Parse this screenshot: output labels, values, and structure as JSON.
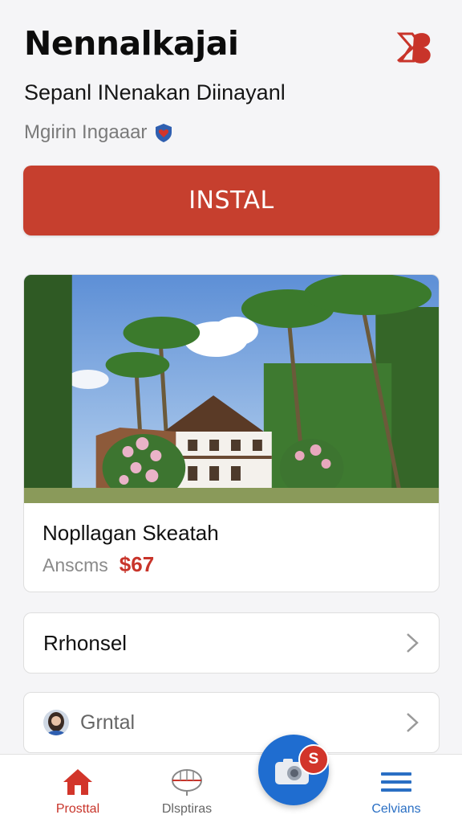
{
  "header": {
    "title": "Nennalkajai",
    "subtitle": "Sepanl INenakan Diinayanl",
    "tagline": "Mgirin Ingaaar",
    "tagline_icon": "heart-shield-icon",
    "logo_icon": "brand-logo-icon"
  },
  "install_button": {
    "label": "INSTAL"
  },
  "card": {
    "image": "tropical-palm-house-photo",
    "title": "Nopllagan Skeatah",
    "meta_label": "Anscms",
    "price": "$67"
  },
  "rows": [
    {
      "label": "Rrhonsel",
      "icon": "chevron-right-icon"
    },
    {
      "label": "Grntal",
      "icon": "chevron-right-icon",
      "avatar": "avatar"
    }
  ],
  "tabbar": {
    "tabs": [
      {
        "label": "Prosttal",
        "icon": "home-icon",
        "active": true
      },
      {
        "label": "Dlsptiras",
        "icon": "globe-icon",
        "active": false
      },
      {
        "label": "Celvians",
        "icon": "menu-icon",
        "active": false
      }
    ],
    "fab": {
      "icon": "camera-icon",
      "badge": "S"
    }
  },
  "colors": {
    "accent_red": "#c63f2e",
    "price_red": "#c8342a",
    "fab_blue": "#1f6dd0",
    "menu_blue": "#2a6fc4"
  }
}
